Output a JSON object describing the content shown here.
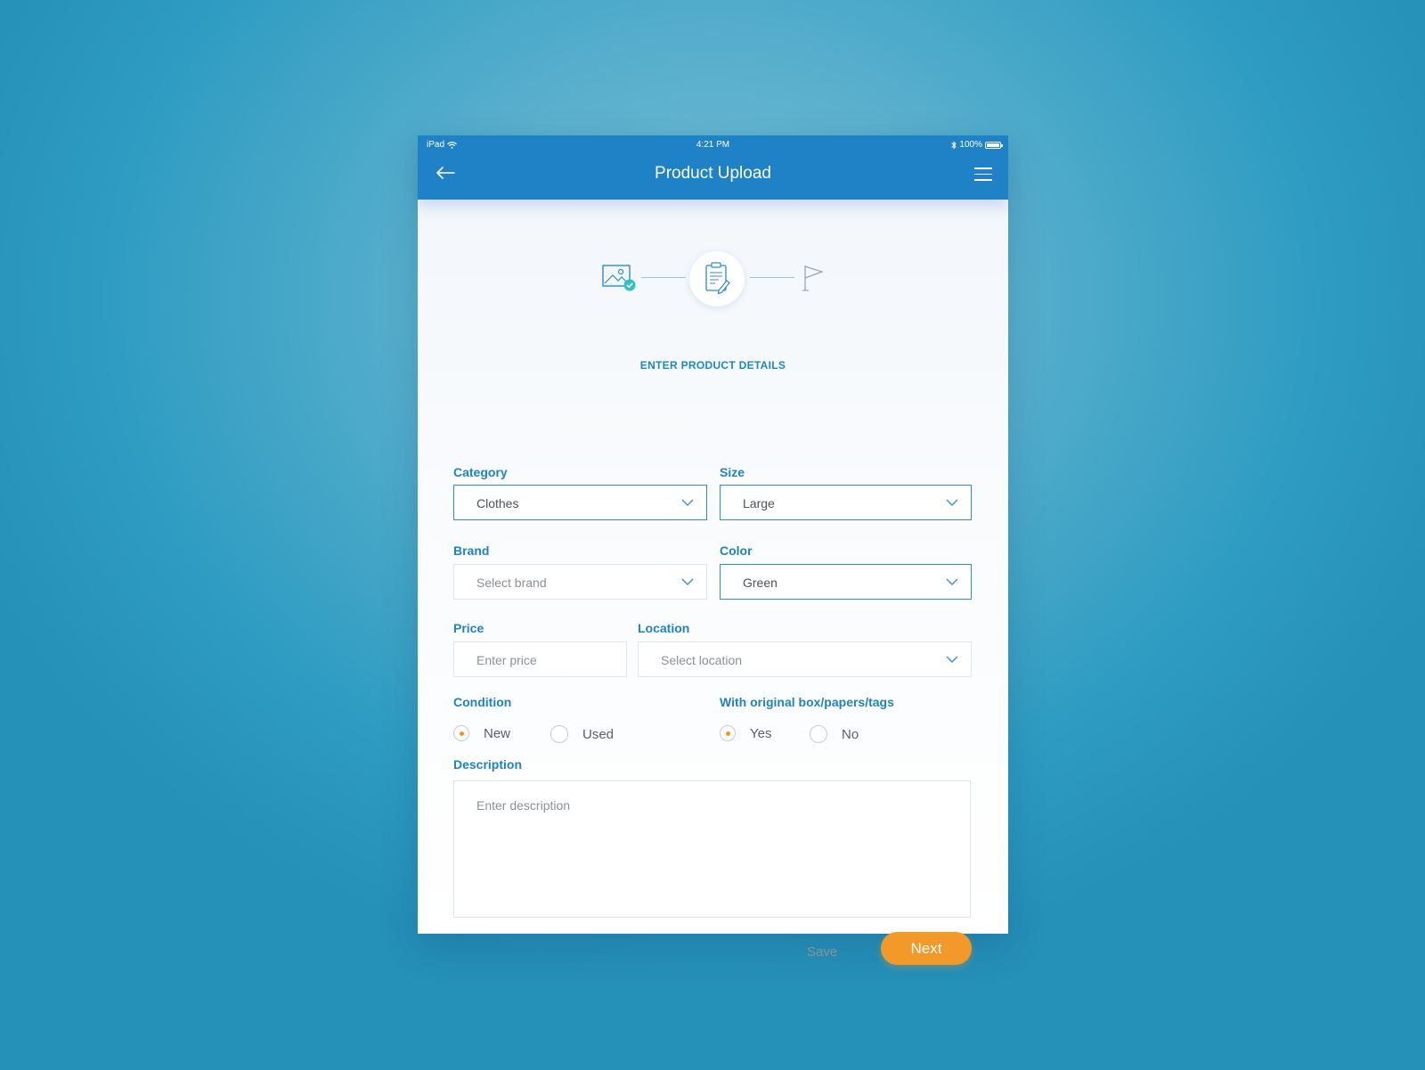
{
  "status_bar": {
    "device": "iPad",
    "time": "4:21 PM",
    "battery": "100%"
  },
  "app_bar": {
    "title": "Product Upload",
    "back_icon": "arrow-left-icon",
    "menu_icon": "hamburger-menu-icon"
  },
  "stepper": {
    "steps": [
      {
        "icon": "image-check-icon",
        "state": "completed"
      },
      {
        "icon": "clipboard-edit-icon",
        "state": "active"
      },
      {
        "icon": "flag-icon",
        "state": "pending"
      }
    ],
    "current_label": "ENTER PRODUCT DETAILS"
  },
  "form": {
    "category": {
      "label": "Category",
      "value": "Clothes"
    },
    "size": {
      "label": "Size",
      "value": "Large"
    },
    "brand": {
      "label": "Brand",
      "placeholder": "Select brand"
    },
    "color": {
      "label": "Color",
      "value": "Green"
    },
    "price": {
      "label": "Price",
      "placeholder": "Enter price"
    },
    "location": {
      "label": "Location",
      "placeholder": "Select location"
    },
    "condition": {
      "label": "Condition",
      "options": [
        "New",
        "Used"
      ],
      "selected": "New"
    },
    "original_box": {
      "label": "With original box/papers/tags",
      "options": [
        "Yes",
        "No"
      ],
      "selected": "Yes"
    },
    "description": {
      "label": "Description",
      "placeholder": "Enter description"
    }
  },
  "actions": {
    "save_label": "Save",
    "next_label": "Next"
  },
  "colors": {
    "app_bar": "#1f82c6",
    "accent": "#1f82c3",
    "primary_button": "#f3992a",
    "radio_selected": "#f3971f"
  }
}
